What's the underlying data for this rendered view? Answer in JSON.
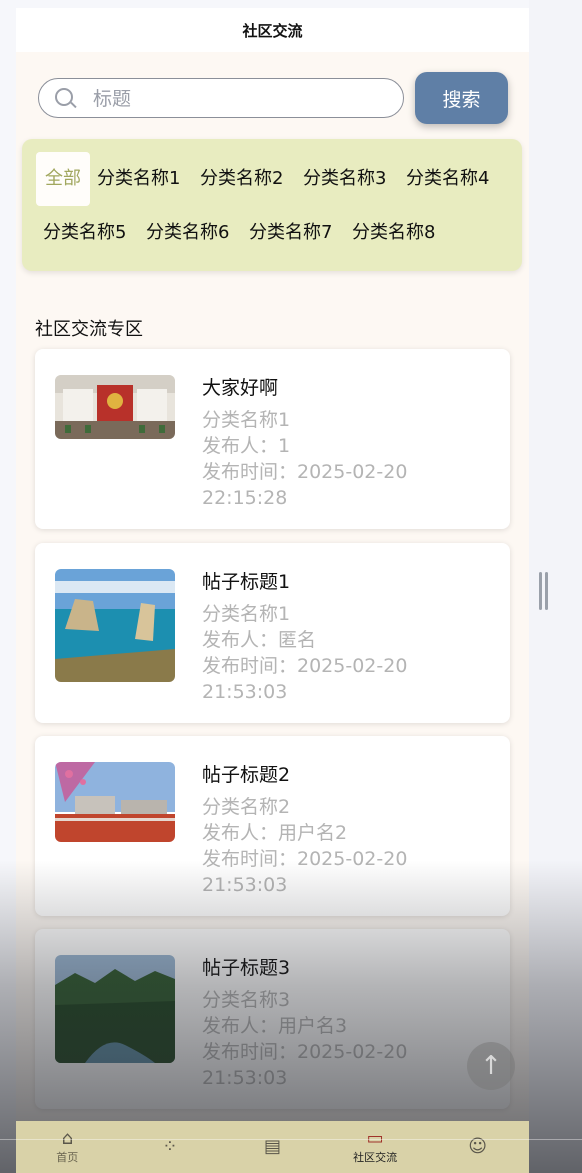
{
  "header": {
    "title": "社区交流"
  },
  "search": {
    "placeholder": "标题",
    "button_label": "搜索"
  },
  "categories": {
    "items": [
      "全部",
      "分类名称1",
      "分类名称2",
      "分类名称3",
      "分类名称4",
      "分类名称5",
      "分类名称6",
      "分类名称7",
      "分类名称8"
    ],
    "active": "全部"
  },
  "section": {
    "title": "社区交流专区"
  },
  "posts": [
    {
      "title": "大家好啊",
      "category": "分类名称1",
      "author": "发布人：1",
      "time_line1": "发布时间：2025-02-20",
      "time_line2": "22:15:28"
    },
    {
      "title": "帖子标题1",
      "category": "分类名称1",
      "author": "发布人：匿名",
      "time_line1": "发布时间：2025-02-20",
      "time_line2": "21:53:03"
    },
    {
      "title": "帖子标题2",
      "category": "分类名称2",
      "author": "发布人：用户名2",
      "time_line1": "发布时间：2025-02-20",
      "time_line2": "21:53:03"
    },
    {
      "title": "帖子标题3",
      "category": "分类名称3",
      "author": "发布人：用户名3",
      "time_line1": "发布时间：2025-02-20",
      "time_line2": "21:53:03"
    }
  ],
  "tabbar": {
    "items": [
      {
        "label": "首页",
        "icon": "home-icon"
      },
      {
        "label": "",
        "icon": "grid-icon"
      },
      {
        "label": "",
        "icon": "board-icon"
      },
      {
        "label": "社区交流",
        "icon": "chat-icon"
      },
      {
        "label": "",
        "icon": "user-icon"
      }
    ],
    "active": "社区交流"
  },
  "colors": {
    "accent": "#5f7fa6",
    "category_panel": "#e8ecc0",
    "active_tab": "#a0322a"
  }
}
